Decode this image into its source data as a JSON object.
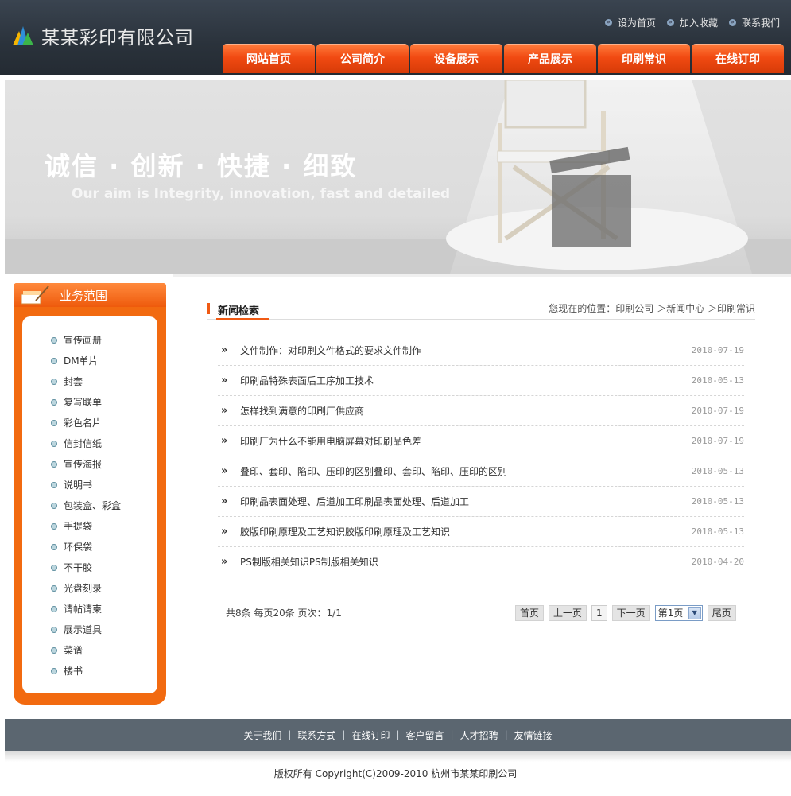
{
  "header": {
    "company_name": "某某彩印有限公司",
    "top_links": [
      "设为首页",
      "加入收藏",
      "联系我们"
    ],
    "nav": [
      "网站首页",
      "公司简介",
      "设备展示",
      "产品展示",
      "印刷常识",
      "在线订印"
    ]
  },
  "banner": {
    "slogan_cn": "诚信 · 创新 · 快捷 · 细致",
    "slogan_en": "Our aim is Integrity, innovation, fast and detailed"
  },
  "sidebar": {
    "title": "业务范围",
    "items": [
      "宣传画册",
      "DM单片",
      "封套",
      "复写联单",
      "彩色名片",
      "信封信纸",
      "宣传海报",
      "说明书",
      "包装盒、彩盒",
      "手提袋",
      "环保袋",
      "不干胶",
      "光盘刻录",
      "请帖请柬",
      "展示道具",
      "菜谱",
      "楼书"
    ]
  },
  "content": {
    "title": "新闻检索",
    "breadcrumb": {
      "prefix": "您现在的位置：",
      "items": [
        "印刷公司",
        "新闻中心",
        "印刷常识"
      ],
      "sep": "＞"
    },
    "news": [
      {
        "title": "文件制作：对印刷文件格式的要求文件制作",
        "date": "2010-07-19"
      },
      {
        "title": "印刷品特殊表面后工序加工技术",
        "date": "2010-05-13"
      },
      {
        "title": "怎样找到满意的印刷厂供应商",
        "date": "2010-07-19"
      },
      {
        "title": "印刷厂为什么不能用电脑屏幕对印刷品色差",
        "date": "2010-07-19"
      },
      {
        "title": "叠印、套印、陷印、压印的区别叠印、套印、陷印、压印的区别",
        "date": "2010-05-13"
      },
      {
        "title": "印刷品表面处理、后道加工印刷品表面处理、后道加工",
        "date": "2010-05-13"
      },
      {
        "title": "胶版印刷原理及工艺知识胶版印刷原理及工艺知识",
        "date": "2010-05-13"
      },
      {
        "title": "PS制版相关知识PS制版相关知识",
        "date": "2010-04-20"
      }
    ],
    "pager": {
      "info": "共8条  每页20条  页次：1/1",
      "first": "首页",
      "prev": "上一页",
      "current": "1",
      "next": "下一页",
      "select": "第1页",
      "last": "尾页"
    }
  },
  "footer": {
    "links": [
      "关于我们",
      "联系方式",
      "在线订印",
      "客户留言",
      "人才招聘",
      "友情链接"
    ],
    "copyright": "版权所有  Copyright(C)2009-2010 杭州市某某印刷公司"
  },
  "colors": {
    "accent": "#f05a14",
    "header_bg": "#2e3640",
    "footer_bg": "#5b6670"
  }
}
